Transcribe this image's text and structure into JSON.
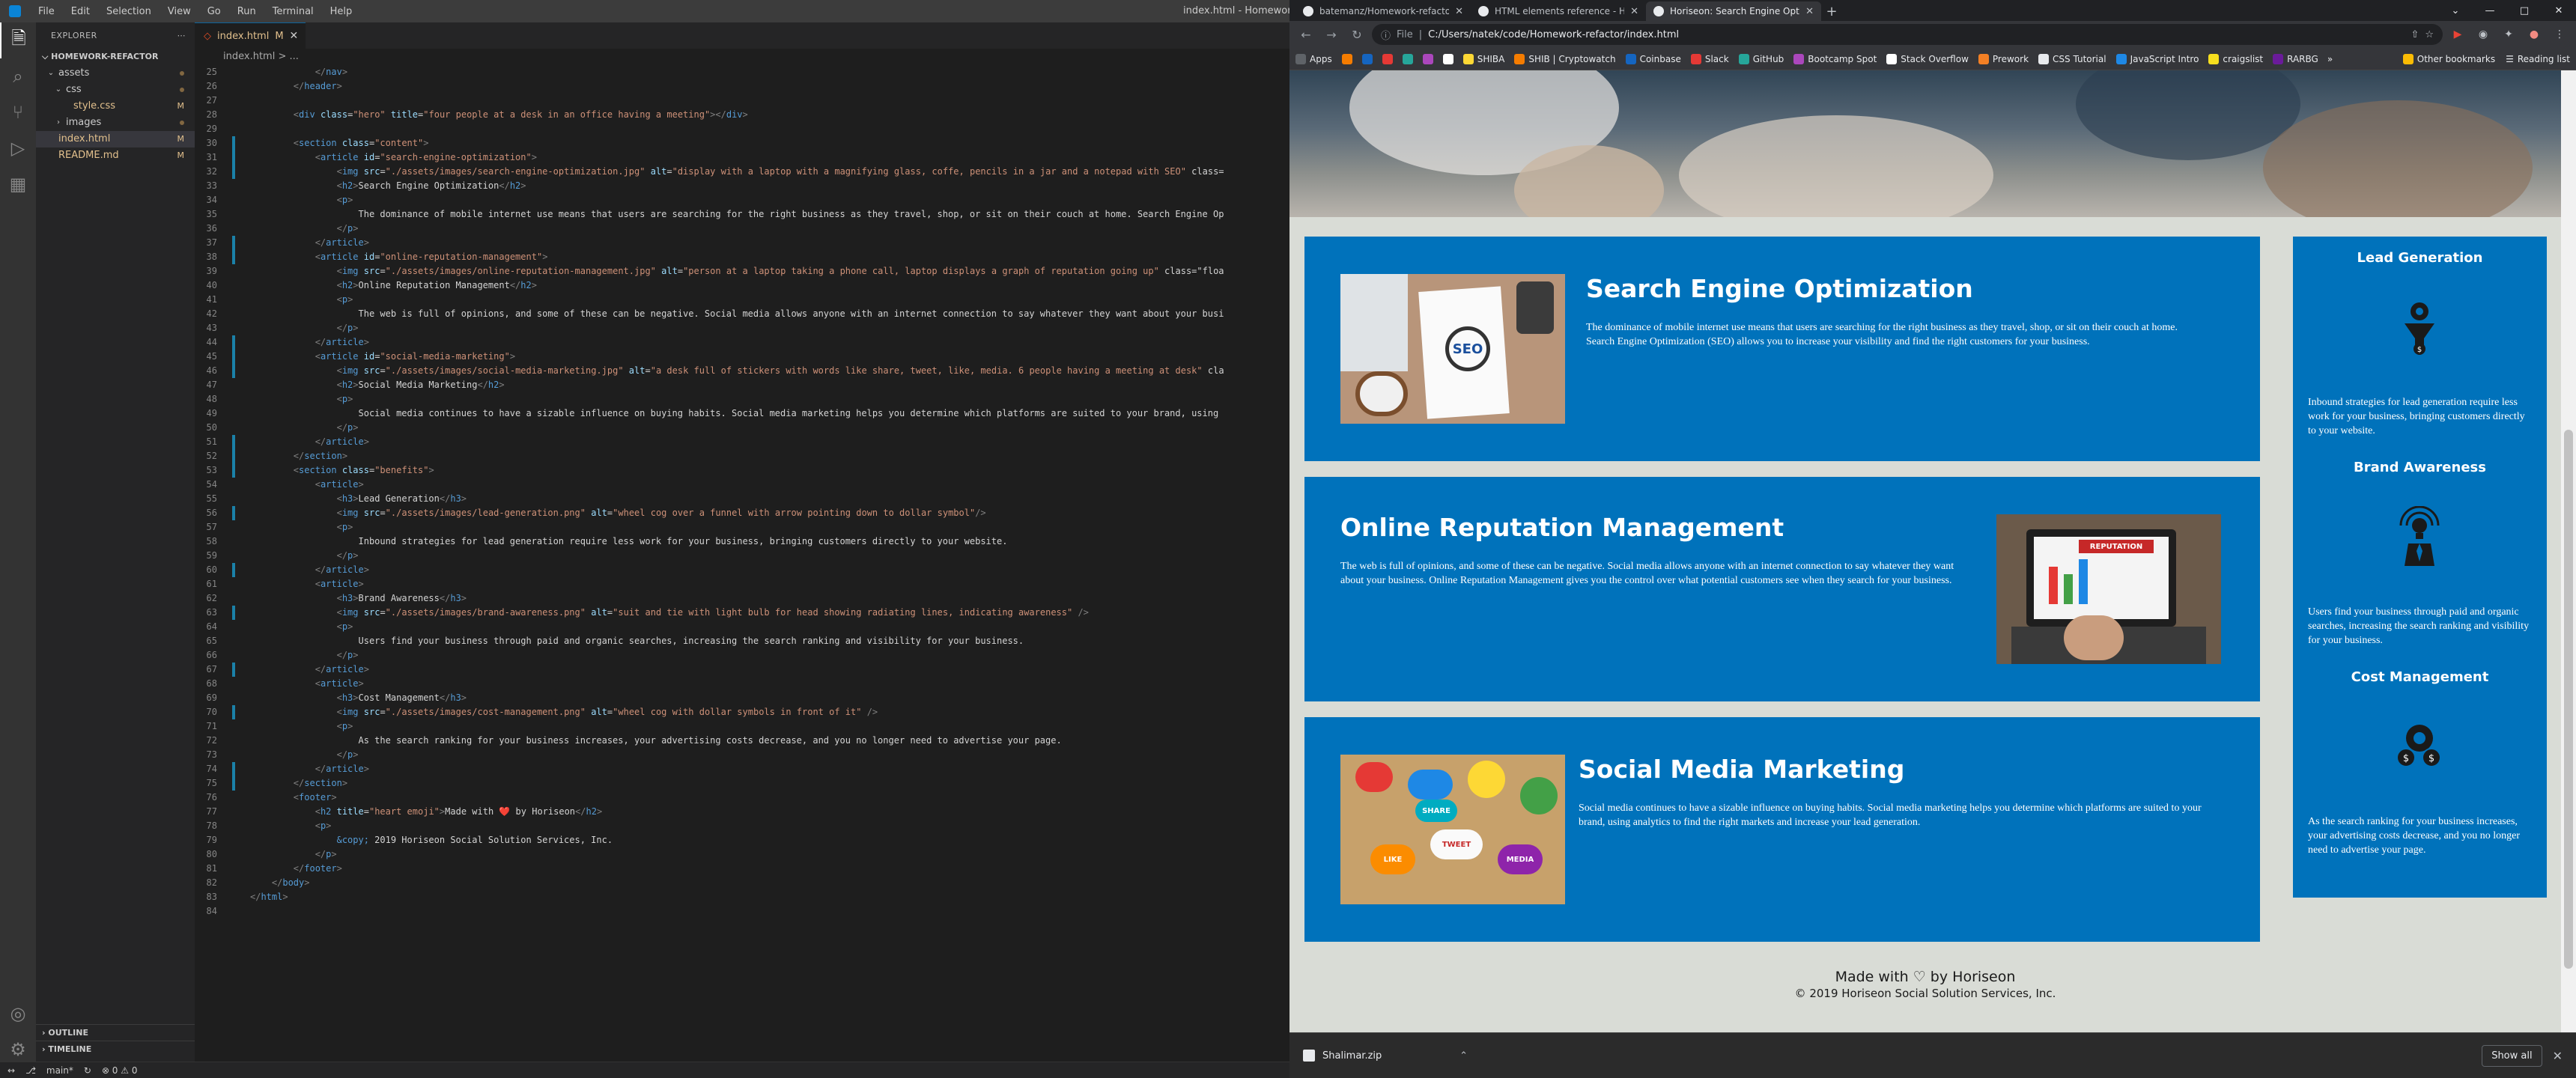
{
  "vscode": {
    "menu": [
      "File",
      "Edit",
      "Selection",
      "View",
      "Go",
      "Run",
      "Terminal",
      "Help"
    ],
    "window_title": "index.html - Homework-re",
    "explorer": {
      "header": "EXPLORER",
      "project": "HOMEWORK-REFACTOR",
      "tree": [
        {
          "label": "assets",
          "type": "folder",
          "open": true,
          "indent": 0,
          "badge": "",
          "modified": false
        },
        {
          "label": "css",
          "type": "folder",
          "open": true,
          "indent": 1,
          "badge": "",
          "modified": false
        },
        {
          "label": "style.css",
          "type": "file",
          "indent": 2,
          "badge": "M",
          "modified": true
        },
        {
          "label": "images",
          "type": "folder",
          "open": false,
          "indent": 1,
          "badge": "",
          "modified": false
        },
        {
          "label": "index.html",
          "type": "file",
          "indent": 0,
          "badge": "M",
          "modified": true,
          "selected": true
        },
        {
          "label": "README.md",
          "type": "file",
          "indent": 0,
          "badge": "M",
          "modified": true
        }
      ],
      "outline": "OUTLINE",
      "timeline": "TIMELINE"
    },
    "tab": {
      "label": "index.html",
      "badge": "M"
    },
    "breadcrumb": "index.html > ...",
    "code_lines": [
      {
        "n": 25,
        "c": "            </nav>",
        "m": false
      },
      {
        "n": 26,
        "c": "        </header>",
        "m": false
      },
      {
        "n": 27,
        "c": "",
        "m": false
      },
      {
        "n": 28,
        "c": "        <div class=\"hero\" title=\"four people at a desk in an office having a meeting\"></div>",
        "m": false
      },
      {
        "n": 29,
        "c": "",
        "m": false
      },
      {
        "n": 30,
        "c": "        <section class=\"content\">",
        "m": true
      },
      {
        "n": 31,
        "c": "            <article id=\"search-engine-optimization\">",
        "m": true
      },
      {
        "n": 32,
        "c": "                <img src=\"./assets/images/search-engine-optimization.jpg\" alt=\"display with a laptop with a magnifying glass, coffe, pencils in a jar and a notepad with SEO\" class=",
        "m": true
      },
      {
        "n": 33,
        "c": "                <h2>Search Engine Optimization</h2>",
        "m": false
      },
      {
        "n": 34,
        "c": "                <p>",
        "m": false
      },
      {
        "n": 35,
        "c": "                    The dominance of mobile internet use means that users are searching for the right business as they travel, shop, or sit on their couch at home. Search Engine Op",
        "m": false
      },
      {
        "n": 36,
        "c": "                </p>",
        "m": false
      },
      {
        "n": 37,
        "c": "            </article>",
        "m": true
      },
      {
        "n": 38,
        "c": "            <article id=\"online-reputation-management\">",
        "m": true
      },
      {
        "n": 39,
        "c": "                <img src=\"./assets/images/online-reputation-management.jpg\" alt=\"person at a laptop taking a phone call, laptop displays a graph of reputation going up\" class=\"floa",
        "m": false
      },
      {
        "n": 40,
        "c": "                <h2>Online Reputation Management</h2>",
        "m": false
      },
      {
        "n": 41,
        "c": "                <p>",
        "m": false
      },
      {
        "n": 42,
        "c": "                    The web is full of opinions, and some of these can be negative. Social media allows anyone with an internet connection to say whatever they want about your busi",
        "m": false
      },
      {
        "n": 43,
        "c": "                </p>",
        "m": false
      },
      {
        "n": 44,
        "c": "            </article>",
        "m": true
      },
      {
        "n": 45,
        "c": "            <article id=\"social-media-marketing\">",
        "m": true
      },
      {
        "n": 46,
        "c": "                <img src=\"./assets/images/social-media-marketing.jpg\" alt=\"a desk full of stickers with words like share, tweet, like, media. 6 people having a meeting at desk\" cla",
        "m": true
      },
      {
        "n": 47,
        "c": "                <h2>Social Media Marketing</h2>",
        "m": false
      },
      {
        "n": 48,
        "c": "                <p>",
        "m": false
      },
      {
        "n": 49,
        "c": "                    Social media continues to have a sizable influence on buying habits. Social media marketing helps you determine which platforms are suited to your brand, using",
        "m": false
      },
      {
        "n": 50,
        "c": "                </p>",
        "m": false
      },
      {
        "n": 51,
        "c": "            </article>",
        "m": true
      },
      {
        "n": 52,
        "c": "        </section>",
        "m": true
      },
      {
        "n": 53,
        "c": "        <section class=\"benefits\">",
        "m": true
      },
      {
        "n": 54,
        "c": "            <article>",
        "m": false
      },
      {
        "n": 55,
        "c": "                <h3>Lead Generation</h3>",
        "m": false
      },
      {
        "n": 56,
        "c": "                <img src=\"./assets/images/lead-generation.png\" alt=\"wheel cog over a funnel with arrow pointing down to dollar symbol\"/>",
        "m": true
      },
      {
        "n": 57,
        "c": "                <p>",
        "m": false
      },
      {
        "n": 58,
        "c": "                    Inbound strategies for lead generation require less work for your business, bringing customers directly to your website.",
        "m": false
      },
      {
        "n": 59,
        "c": "                </p>",
        "m": false
      },
      {
        "n": 60,
        "c": "            </article>",
        "m": true
      },
      {
        "n": 61,
        "c": "            <article>",
        "m": false
      },
      {
        "n": 62,
        "c": "                <h3>Brand Awareness</h3>",
        "m": false
      },
      {
        "n": 63,
        "c": "                <img src=\"./assets/images/brand-awareness.png\" alt=\"suit and tie with light bulb for head showing radiating lines, indicating awareness\" />",
        "m": true
      },
      {
        "n": 64,
        "c": "                <p>",
        "m": false
      },
      {
        "n": 65,
        "c": "                    Users find your business through paid and organic searches, increasing the search ranking and visibility for your business.",
        "m": false
      },
      {
        "n": 66,
        "c": "                </p>",
        "m": false
      },
      {
        "n": 67,
        "c": "            </article>",
        "m": true
      },
      {
        "n": 68,
        "c": "            <article>",
        "m": false
      },
      {
        "n": 69,
        "c": "                <h3>Cost Management</h3>",
        "m": false
      },
      {
        "n": 70,
        "c": "                <img src=\"./assets/images/cost-management.png\" alt=\"wheel cog with dollar symbols in front of it\" />",
        "m": true
      },
      {
        "n": 71,
        "c": "                <p>",
        "m": false
      },
      {
        "n": 72,
        "c": "                    As the search ranking for your business increases, your advertising costs decrease, and you no longer need to advertise your page.",
        "m": false
      },
      {
        "n": 73,
        "c": "                </p>",
        "m": false
      },
      {
        "n": 74,
        "c": "            </article>",
        "m": true
      },
      {
        "n": 75,
        "c": "        </section>",
        "m": true
      },
      {
        "n": 76,
        "c": "        <footer>",
        "m": false
      },
      {
        "n": 77,
        "c": "            <h2 title=\"heart emoji\">Made with ❤️ by Horiseon</h2>",
        "m": false
      },
      {
        "n": 78,
        "c": "            <p>",
        "m": false
      },
      {
        "n": 79,
        "c": "                &copy; 2019 Horiseon Social Solution Services, Inc.",
        "m": false
      },
      {
        "n": 80,
        "c": "            </p>",
        "m": false
      },
      {
        "n": 81,
        "c": "        </footer>",
        "m": false
      },
      {
        "n": 82,
        "c": "    </body>",
        "m": false
      },
      {
        "n": 83,
        "c": "</html>",
        "m": false
      },
      {
        "n": 84,
        "c": "",
        "m": false
      }
    ],
    "status": {
      "branch": "main*",
      "problems": "⊗ 0 ⚠ 0"
    }
  },
  "chrome": {
    "tabs": [
      {
        "title": "batemanz/Homework-refactor: I",
        "active": false
      },
      {
        "title": "HTML elements reference - HTML",
        "active": false
      },
      {
        "title": "Horiseon: Search Engine Optimiz",
        "active": true
      }
    ],
    "url_scheme": "File",
    "url": "C:/Users/natek/code/Homework-refactor/index.html",
    "bookmarks": [
      "Apps",
      "SHIBA",
      "SHIB | Cryptowatch",
      "Coinbase",
      "Slack",
      "GitHub",
      "Bootcamp Spot",
      "Stack Overflow",
      "Prework",
      "CSS Tutorial",
      "JavaScript Intro",
      "craigslist",
      "RARBG"
    ],
    "bookmarks_more": "»",
    "other_bookmarks": "Other bookmarks",
    "reading_list": "Reading list",
    "page": {
      "content": [
        {
          "title": "Search Engine Optimization",
          "text": "The dominance of mobile internet use means that users are searching for the right business as they travel, shop, or sit on their couch at home. Search Engine Optimization (SEO) allows you to increase your visibility and find the right customers for your business.",
          "image_side": "left"
        },
        {
          "title": "Online Reputation Management",
          "text": "The web is full of opinions, and some of these can be negative. Social media allows anyone with an internet connection to say whatever they want about your business. Online Reputation Management gives you the control over what potential customers see when they search for your business.",
          "image_side": "right"
        },
        {
          "title": "Social Media Marketing",
          "text": "Social media continues to have a sizable influence on buying habits. Social media marketing helps you determine which platforms are suited to your brand, using analytics to find the right markets and increase your lead generation.",
          "image_side": "left"
        }
      ],
      "seo_image_text": "SEO",
      "orm_image_text": "REPUTATION",
      "smm_image_words": [
        "LIKE",
        "TWEET",
        "SHARE",
        "MEDIA"
      ],
      "benefits": [
        {
          "title": "Lead Generation",
          "text": "Inbound strategies for lead generation require less work for your business, bringing customers directly to your website.",
          "icon": "cog-funnel-dollar-icon"
        },
        {
          "title": "Brand Awareness",
          "text": "Users find your business through paid and organic searches, increasing the search ranking and visibility for your business.",
          "icon": "lightbulb-head-icon"
        },
        {
          "title": "Cost Management",
          "text": "As the search ranking for your business increases, your advertising costs decrease, and you no longer need to advertise your page.",
          "icon": "cog-dollar-icon"
        }
      ],
      "footer_title": "Made with ♡ by Horiseon",
      "footer_copyright": "© 2019 Horiseon Social Solution Services, Inc."
    },
    "download": {
      "file": "Shalimar.zip",
      "show_all": "Show all"
    }
  },
  "colors": {
    "accent": "#0072bb",
    "page_bg": "#d9dcd6",
    "vscode_bg": "#1e1e1e",
    "modified": "#e2c08d"
  }
}
